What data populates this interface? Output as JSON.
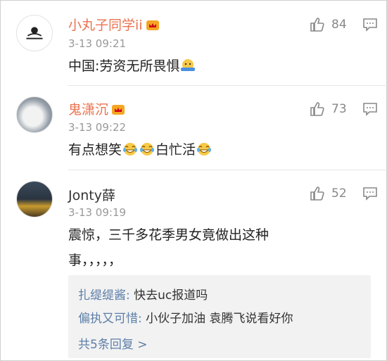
{
  "comments": [
    {
      "username": "小丸子同学ii",
      "vip_icon": "vip-crown-badge",
      "time": "3-13 09:21",
      "text": "中国:劳资无所畏惧",
      "emoji": "shrug-emoji",
      "likes": "84"
    },
    {
      "username": "鬼潇沉",
      "vip_icon": "vip-crown-badge",
      "time": "3-13 09:22",
      "text_1": "有点想笑",
      "text_2": "白忙活",
      "emoji": "laugh-cry-emoji",
      "likes": "73"
    },
    {
      "username": "Jonty薛",
      "time": "3-13 09:19",
      "text_line1": "震惊，三千多花季男女竟做出这种",
      "text_line2": "事，，，，，",
      "likes": "52",
      "replies": [
        {
          "user": "扎缇缇酱:",
          "text": " 快去uc报道吗"
        },
        {
          "user": "偏执又可惜:",
          "text": " 小伙子加油 袁腾飞说看好你"
        }
      ],
      "more_label": "共5条回复 >"
    }
  ],
  "icons": {
    "like": "thumbs-up-icon",
    "reply": "comment-bubble-icon"
  },
  "colors": {
    "username": "#eb7350",
    "reply_user": "#5d7fa8",
    "meta": "#999999"
  }
}
